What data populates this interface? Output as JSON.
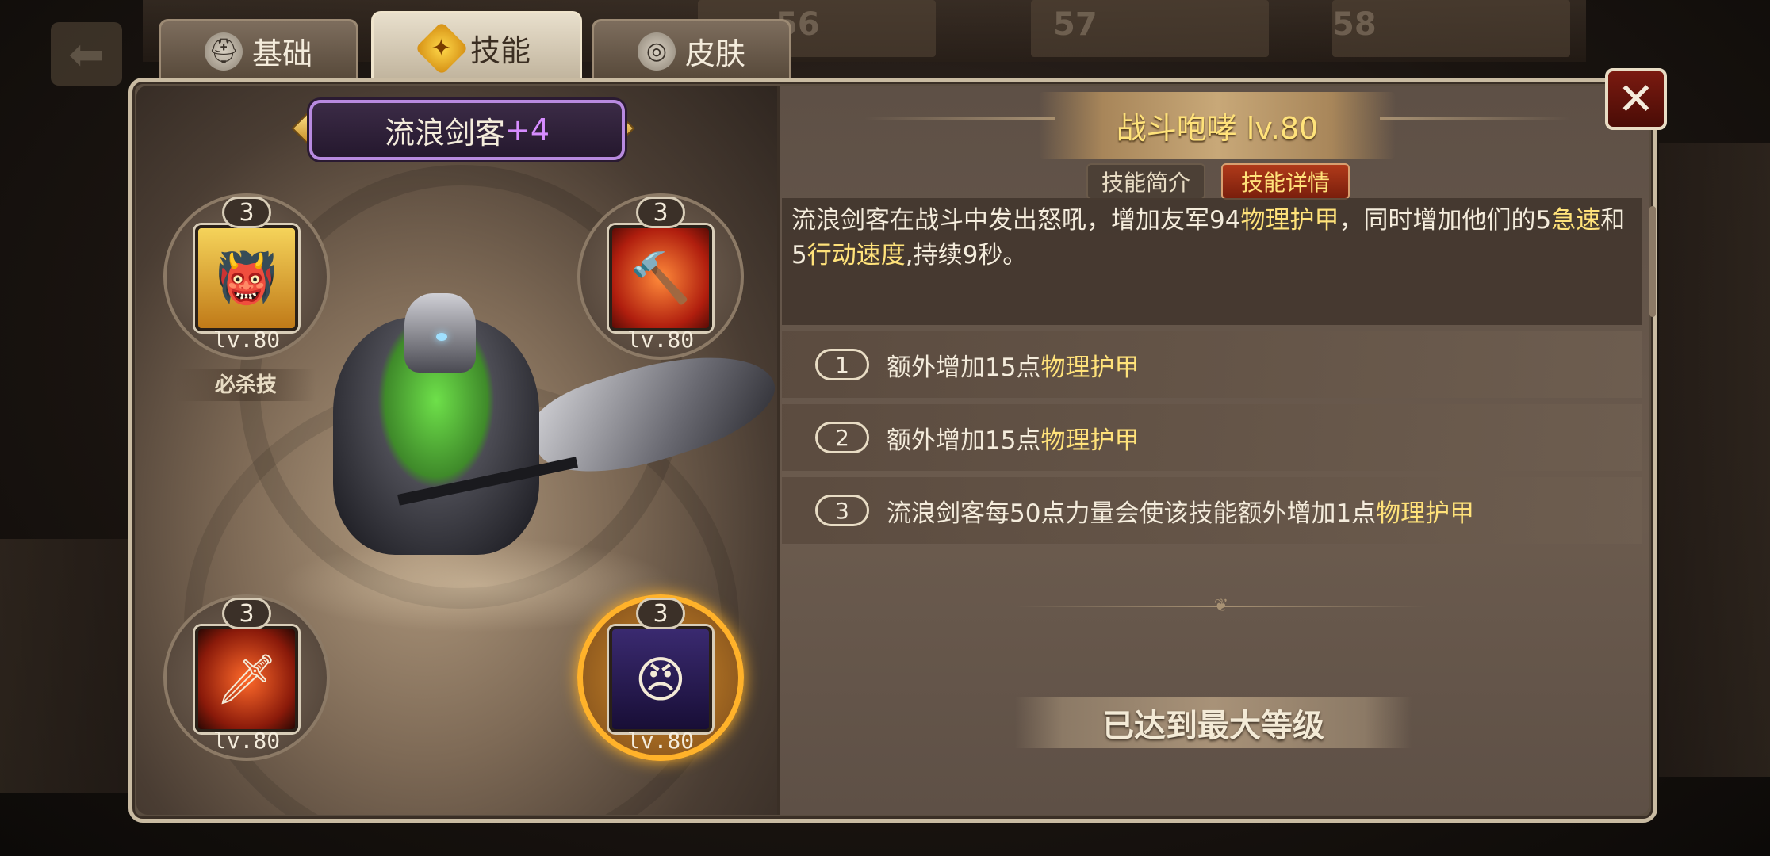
{
  "tabs": [
    {
      "label": "基础",
      "icon": "helmet-icon"
    },
    {
      "label": "技能",
      "icon": "skill-emblem-icon",
      "active": true
    },
    {
      "label": "皮肤",
      "icon": "mask-icon"
    }
  ],
  "background": {
    "card_numbers": [
      "56",
      "57",
      "58"
    ]
  },
  "hero": {
    "name": "流浪剑客",
    "plus": "+4"
  },
  "skills": [
    {
      "id": "skill-1",
      "rank": "3",
      "level": "lv.80",
      "icon": "orc-warrior-portrait-icon",
      "tag": "必杀技"
    },
    {
      "id": "skill-2",
      "rank": "3",
      "level": "lv.80",
      "icon": "hammer-icon"
    },
    {
      "id": "skill-3",
      "rank": "3",
      "level": "lv.80",
      "icon": "flame-blade-icon"
    },
    {
      "id": "skill-4",
      "rank": "3",
      "level": "lv.80",
      "icon": "shouting-warrior-portrait-icon",
      "selected": true
    }
  ],
  "detail": {
    "title": "战斗咆哮 lv.80",
    "subtab_intro": "技能简介",
    "subtab_detail": "技能详情",
    "description_parts": {
      "p1": "流浪剑客在战斗中发出怒吼，增加友军94",
      "h1": "物理护甲",
      "p2": "，同时增加他们的5",
      "h2": "急速",
      "p3": "和5",
      "h3": "行动速度",
      "p4": ",持续9秒。"
    },
    "upgrades": [
      {
        "num": "1",
        "text": "额外增加15点",
        "highlight": "物理护甲"
      },
      {
        "num": "2",
        "text": "额外增加15点",
        "highlight": "物理护甲"
      },
      {
        "num": "3",
        "text": "流浪剑客每50点力量会使该技能额外增加1点",
        "highlight": "物理护甲"
      }
    ],
    "max_level_text": "已达到最大等级"
  },
  "close_label": "✕",
  "colors": {
    "highlight": "#ffe27a",
    "selected_ring": "#ffb22a",
    "plus_text": "#d68cff"
  }
}
